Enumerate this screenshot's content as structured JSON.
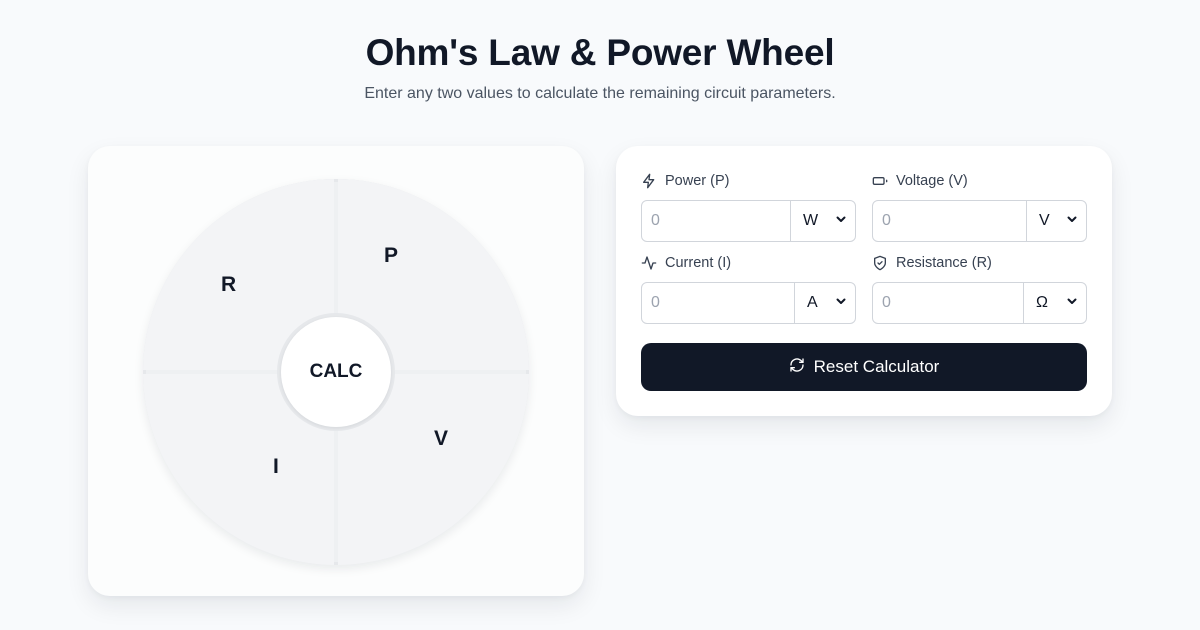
{
  "header": {
    "title": "Ohm's Law & Power Wheel",
    "subtitle": "Enter any two values to calculate the remaining circuit parameters."
  },
  "wheel": {
    "quadrants": {
      "top_left": "R",
      "top_right": "P",
      "bottom_left": "I",
      "bottom_right": "V"
    },
    "center_button": "CALC"
  },
  "form": {
    "power": {
      "label": "Power (P)",
      "icon": "lightning-icon",
      "placeholder": "0",
      "value": "",
      "unit": "W"
    },
    "voltage": {
      "label": "Voltage (V)",
      "icon": "battery-icon",
      "placeholder": "0",
      "value": "",
      "unit": "V"
    },
    "current": {
      "label": "Current (I)",
      "icon": "activity-icon",
      "placeholder": "0",
      "value": "",
      "unit": "A"
    },
    "resistance": {
      "label": "Resistance (R)",
      "icon": "shield-icon",
      "placeholder": "0",
      "value": "",
      "unit": "Ω"
    },
    "reset_label": "Reset Calculator",
    "reset_icon": "refresh-icon"
  },
  "colors": {
    "background": "#f8fafc",
    "text": "#111827",
    "muted": "#4b5563",
    "button": "#111827",
    "wheel": "#f3f4f6"
  }
}
